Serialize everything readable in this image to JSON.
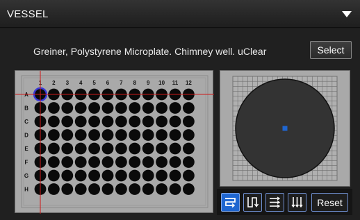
{
  "panel": {
    "title": "VESSEL",
    "collapse_icon": "triangle-down-icon"
  },
  "vessel": {
    "name": "Greiner, Polystyrene Microplate. Chimney well.  uClear",
    "select_label": "Select"
  },
  "plate": {
    "columns": [
      "1",
      "2",
      "3",
      "4",
      "5",
      "6",
      "7",
      "8",
      "9",
      "10",
      "11",
      "12"
    ],
    "rows": [
      "A",
      "B",
      "C",
      "D",
      "E",
      "F",
      "G",
      "H"
    ],
    "selected_well": "A1",
    "colors": {
      "well": "#0a0a0a",
      "selected_ring": "#3a3ad8",
      "crosshair": "#d01818",
      "frame": "#a9a9a9"
    }
  },
  "well_view": {
    "colors": {
      "well": "#333333",
      "grid": "#6e6e6e",
      "site": "#1f66d0"
    }
  },
  "toolbar": {
    "buttons": [
      {
        "icon": "snake-horizontal-icon",
        "active": true
      },
      {
        "icon": "snake-vertical-icon",
        "active": false
      },
      {
        "icon": "raster-horizontal-icon",
        "active": false
      },
      {
        "icon": "raster-vertical-icon",
        "active": false
      }
    ],
    "reset_label": "Reset"
  }
}
